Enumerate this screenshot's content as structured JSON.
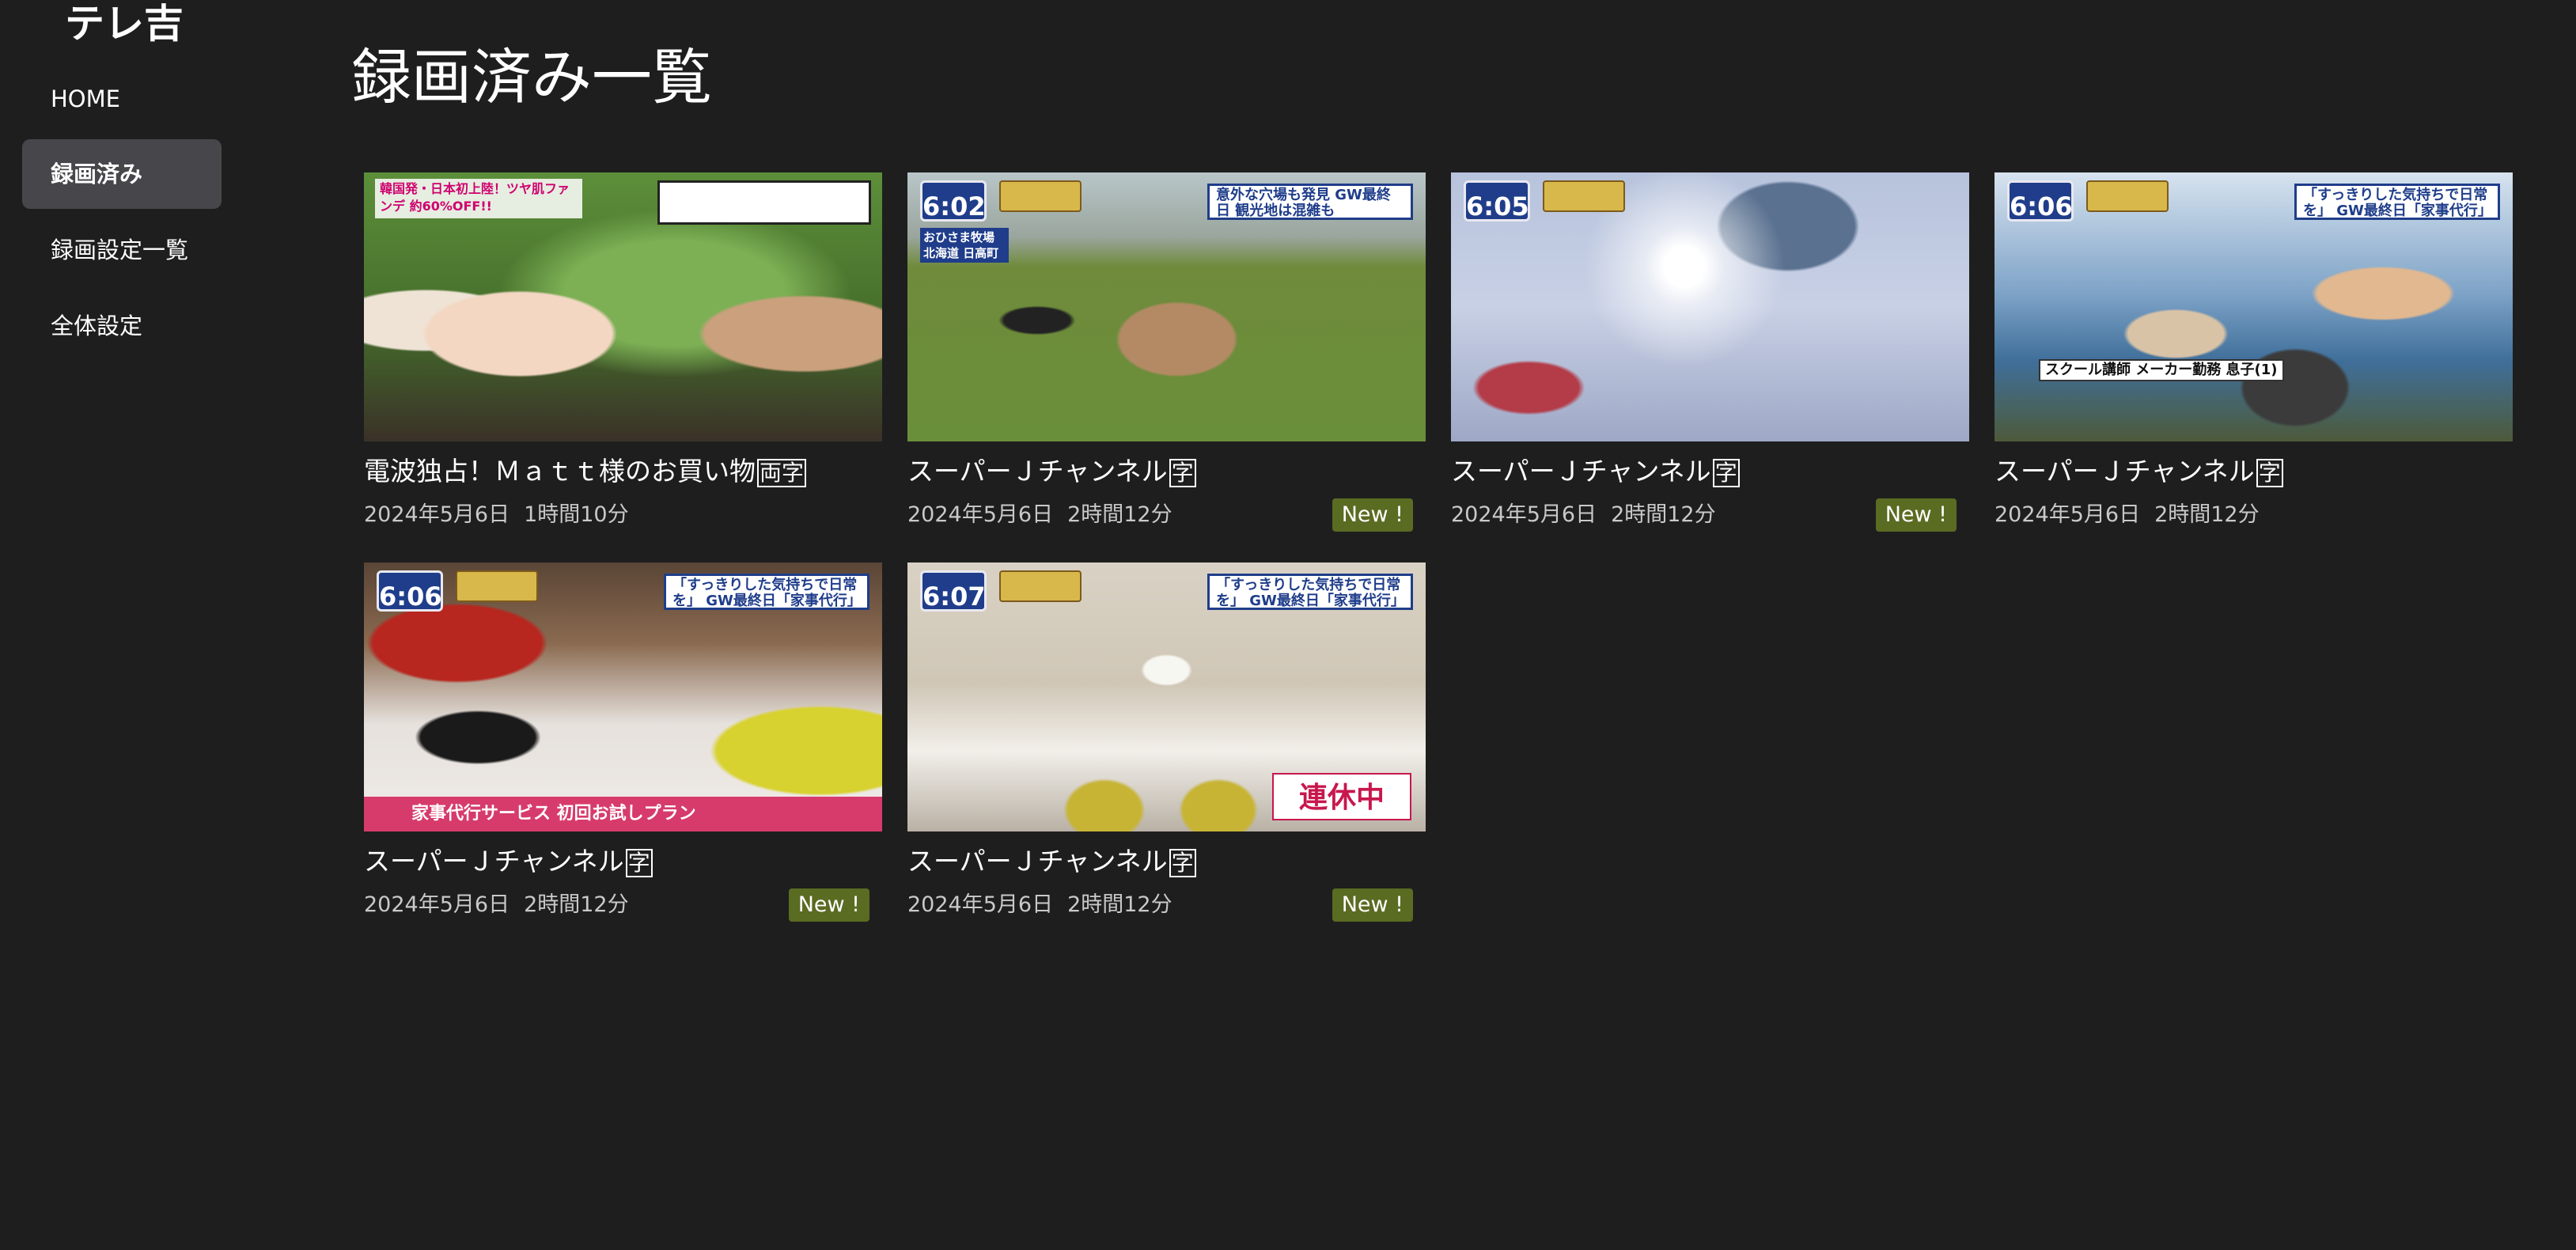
{
  "app": {
    "title": "テレ吉"
  },
  "sidebar": {
    "items": [
      {
        "label": "HOME"
      },
      {
        "label": "録画済み"
      },
      {
        "label": "録画設定一覧"
      },
      {
        "label": "全体設定"
      }
    ],
    "active_index": 1
  },
  "page": {
    "title": "録画済み一覧"
  },
  "recordings": [
    {
      "title": "電波独占！Ｍａｔｔ様のお買い物",
      "subtitle_mark": "両字",
      "date": "2024年5月6日",
      "duration": "1時間10分",
      "new_badge": "",
      "thumb": {
        "theme": "shopping",
        "clock": "",
        "caption": "",
        "lower": "韓国発・日本初上陸！ツヤ肌ファンデ 約60%OFF!!"
      }
    },
    {
      "title": "スーパーＪチャンネル",
      "subtitle_mark": "字",
      "date": "2024年5月6日",
      "duration": "2時間12分",
      "new_badge": "New !",
      "thumb": {
        "theme": "pony",
        "clock": "6:02",
        "caption": "意外な穴場も発見 GW最終日 観光地は混雑も",
        "lower": "おひさま牧場 北海道 日高町"
      }
    },
    {
      "title": "スーパーＪチャンネル",
      "subtitle_mark": "字",
      "date": "2024年5月6日",
      "duration": "2時間12分",
      "new_badge": "New !",
      "thumb": {
        "theme": "sky",
        "clock": "6:05",
        "caption": "",
        "lower": ""
      }
    },
    {
      "title": "スーパーＪチャンネル",
      "subtitle_mark": "字",
      "date": "2024年5月6日",
      "duration": "2時間12分",
      "new_badge": "",
      "thumb": {
        "theme": "beach",
        "clock": "6:06",
        "caption": "「すっきりした気持ちで日常を」 GW最終日「家事代行」が人気",
        "lower": "スクール講師  メーカー勤務  息子(1)"
      }
    },
    {
      "title": "スーパーＪチャンネル",
      "subtitle_mark": "字",
      "date": "2024年5月6日",
      "duration": "2時間12分",
      "new_badge": "New !",
      "thumb": {
        "theme": "cleaning",
        "clock": "6:06",
        "caption": "「すっきりした気持ちで日常を」 GW最終日「家事代行」が人気",
        "lower": "家事代行サービス  初回お試しプラン"
      }
    },
    {
      "title": "スーパーＪチャンネル",
      "subtitle_mark": "字",
      "date": "2024年5月6日",
      "duration": "2時間12分",
      "new_badge": "New !",
      "thumb": {
        "theme": "room",
        "clock": "6:07",
        "caption": "「すっきりした気持ちで日常を」 GW最終日「家事代行」が人気",
        "lower": "連休中"
      }
    }
  ]
}
